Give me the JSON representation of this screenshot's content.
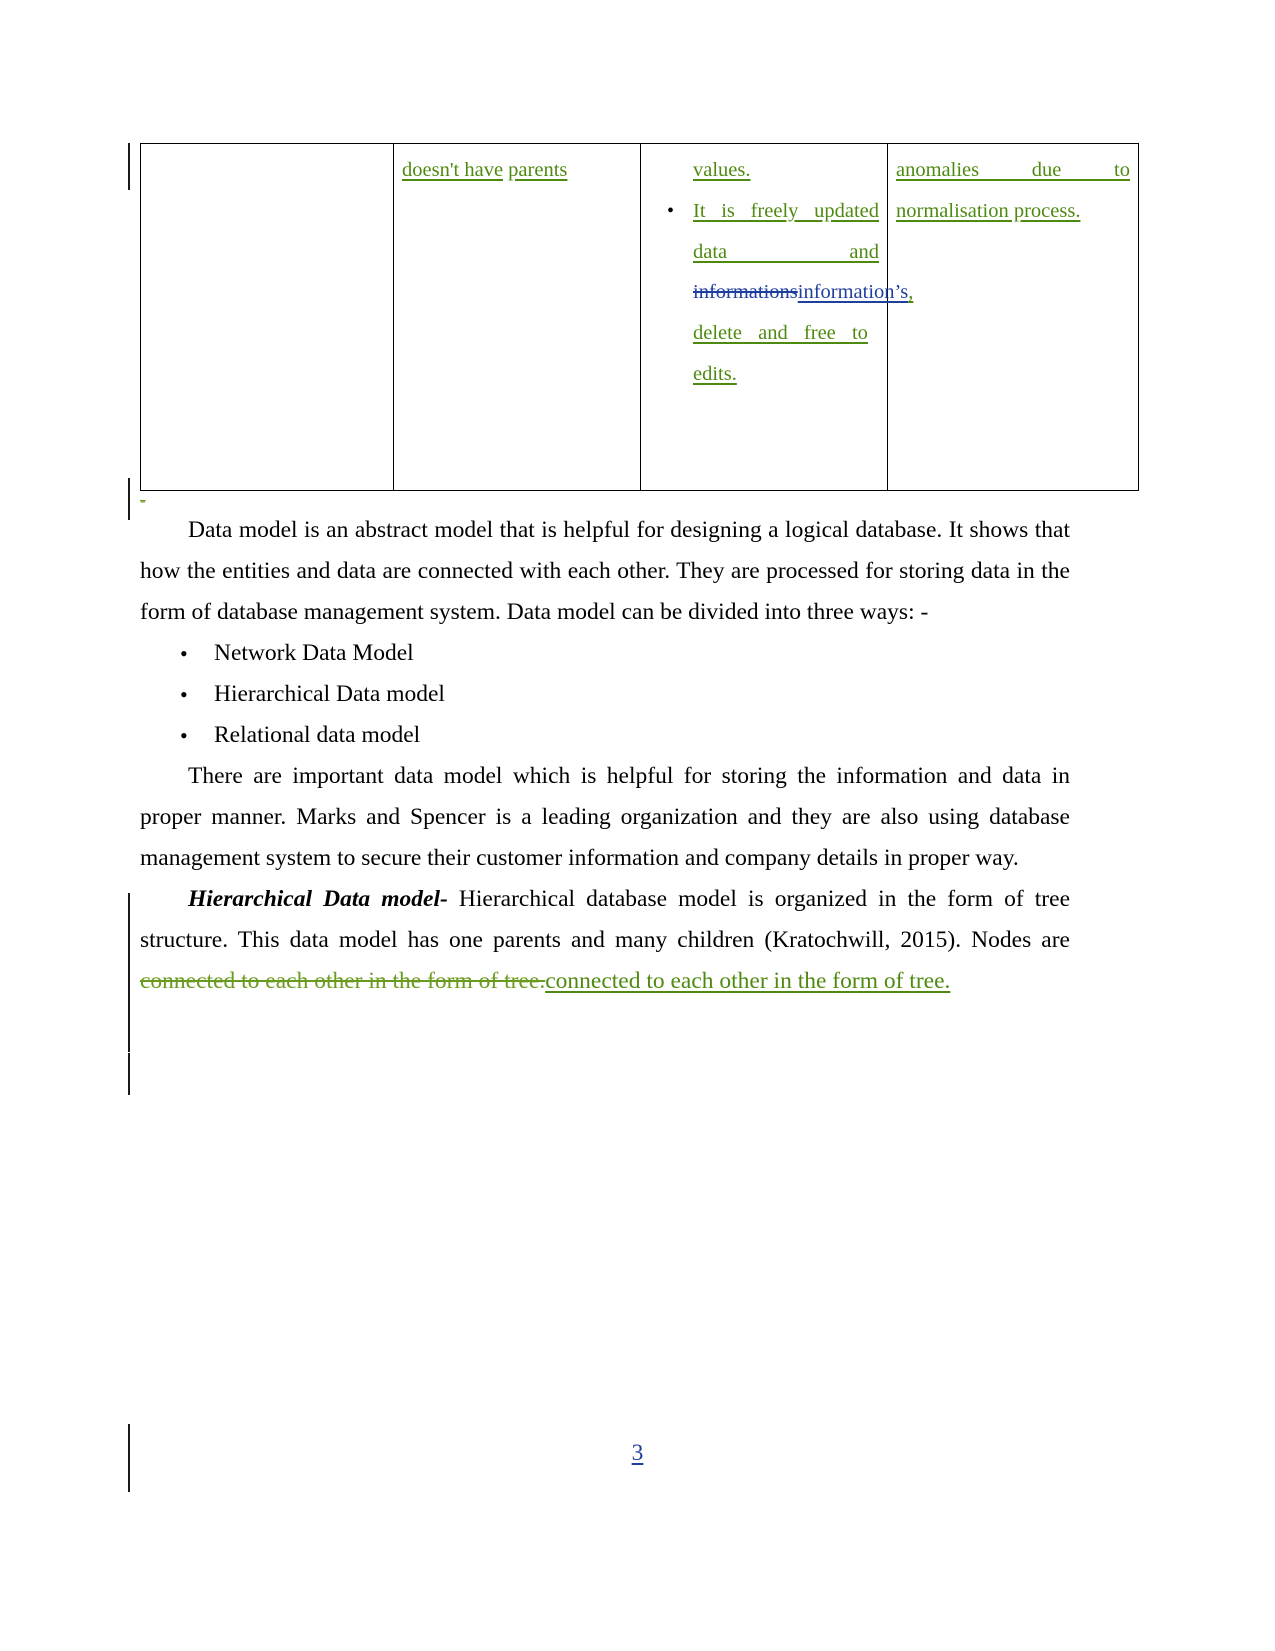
{
  "document": {
    "page_number": "3",
    "colors": {
      "insertion_green": "#4f8a10",
      "deletion_green": "#6a9b1f",
      "insertion_blue": "#1f3f9e",
      "text_black": "#000000",
      "change_bar": "#1a1a1a",
      "table_border": "#000000"
    }
  },
  "table": {
    "columns": [
      {
        "id": "col1",
        "text": ""
      },
      {
        "id": "col2",
        "lines": [
          "doesn't have",
          "parents"
        ]
      },
      {
        "id": "col3",
        "items": [
          {
            "bullet": false,
            "text": "values."
          },
          {
            "bullet": true,
            "text_a": "It is freely updated data and ",
            "deleted": "informations",
            "inserted": "information’s",
            "text_b": ",",
            "text_c": " delete and free to edits. "
          }
        ]
      },
      {
        "id": "col4",
        "lines": [
          "anomalies due to normalisation process."
        ]
      }
    ]
  },
  "body": {
    "stray_mark": "-",
    "paragraph1": "Data model is an abstract model that is helpful for designing a logical database. It shows that how the entities and data are connected with each other. They are processed for storing data in the form of database management system. Data model can be divided into three ways: -",
    "bullets": [
      "Network Data Model",
      "Hierarchical Data model",
      "Relational data model"
    ],
    "paragraph2": "There are important data model which is helpful for storing the information and data in proper manner. Marks and Spencer is a leading organization and they are also using database management system to secure their customer information and company details in proper way.",
    "paragraph3": {
      "lead_bold_italic": "Hierarchical Data model-",
      "text": " Hierarchical database model is organized in the form of tree structure. This data model has one parents and many children (Kratochwill, 2015). Nodes are ",
      "deleted": "connected to each other in the form of tree.",
      "inserted": "connected to each other in the form of tree."
    }
  }
}
